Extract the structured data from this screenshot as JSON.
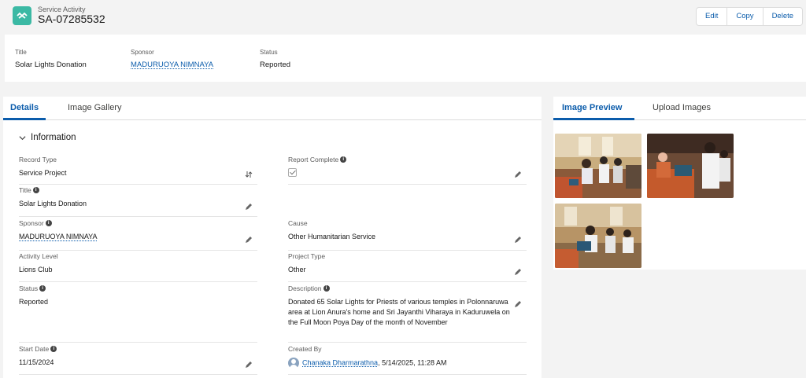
{
  "header": {
    "object_type": "Service Activity",
    "record_name": "SA-07285532",
    "icon": "service-activity-icon",
    "accent": "#3bb9a4",
    "actions": [
      "Edit",
      "Copy",
      "Delete"
    ]
  },
  "highlights": {
    "fields": [
      {
        "label": "Title",
        "value": "Solar Lights Donation"
      },
      {
        "label": "Sponsor",
        "value": "MADURUOYA NIMNAYA"
      },
      {
        "label": "Status",
        "value": "Reported"
      }
    ]
  },
  "left_tabs": [
    "Details",
    "Image Gallery"
  ],
  "section": {
    "title": "Information"
  },
  "fields": {
    "record_type": {
      "label": "Record Type",
      "value": "Service Project"
    },
    "report_complete": {
      "label": "Report Complete",
      "checked": true
    },
    "title": {
      "label": "Title",
      "value": "Solar Lights Donation"
    },
    "sponsor": {
      "label": "Sponsor",
      "value": "MADURUOYA NIMNAYA"
    },
    "cause": {
      "label": "Cause",
      "value": "Other Humanitarian Service"
    },
    "activity_level": {
      "label": "Activity Level",
      "value": "Lions Club"
    },
    "project_type": {
      "label": "Project Type",
      "value": "Other"
    },
    "status": {
      "label": "Status",
      "value": "Reported"
    },
    "description": {
      "label": "Description",
      "value": "Donated 65 Solar Lights for Priests of various temples in Polonnaruwa area at Lion Anura's home and Sri Jayanthi Viharaya in Kaduruwela on the Full Moon Poya Day of the month of November"
    },
    "start_date": {
      "label": "Start Date",
      "value": "11/15/2024"
    },
    "created_by": {
      "label": "Created By",
      "user": "Chanaka Dharmarathna",
      "timestamp": ", 5/14/2025, 11:28 AM"
    }
  },
  "right_tabs": [
    "Image Preview",
    "Upload Images"
  ],
  "colors": {
    "link": "#0b5cab",
    "background": "#f3f3f3"
  }
}
